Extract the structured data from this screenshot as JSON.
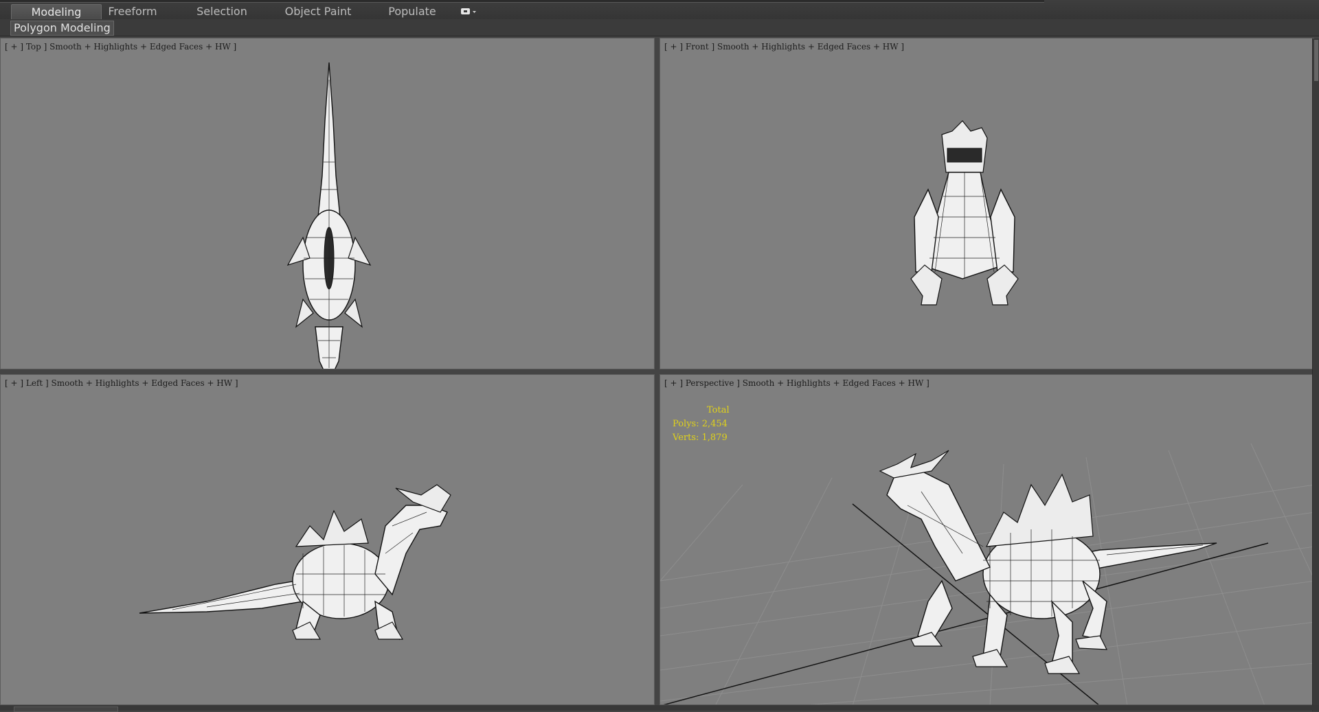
{
  "ribbon": {
    "tabs": [
      {
        "label": "Modeling",
        "active": true
      },
      {
        "label": "Freeform",
        "active": false
      },
      {
        "label": "Selection",
        "active": false
      },
      {
        "label": "Object Paint",
        "active": false
      },
      {
        "label": "Populate",
        "active": false
      }
    ],
    "dropdown_icon": "camera-icon",
    "panel_label": "Polygon Modeling"
  },
  "viewports": {
    "top": {
      "label": "[ + ] Top ] Smooth + Highlights + Edged Faces + HW ]"
    },
    "front": {
      "label": "[ + ] Front ] Smooth + Highlights + Edged Faces + HW ]"
    },
    "left": {
      "label": "[ + ] Left ] Smooth + Highlights + Edged Faces + HW ]"
    },
    "perspective": {
      "label": "[ + ] Perspective ] Smooth + Highlights + Edged Faces + HW ]",
      "stats": {
        "total_label": "Total",
        "polys": "Polys: 2,454",
        "verts": "Verts: 1,879"
      }
    }
  },
  "colors": {
    "viewport_bg": "#7f7f7f",
    "ui_bg": "#444444",
    "stats_text": "#e0d21a"
  }
}
